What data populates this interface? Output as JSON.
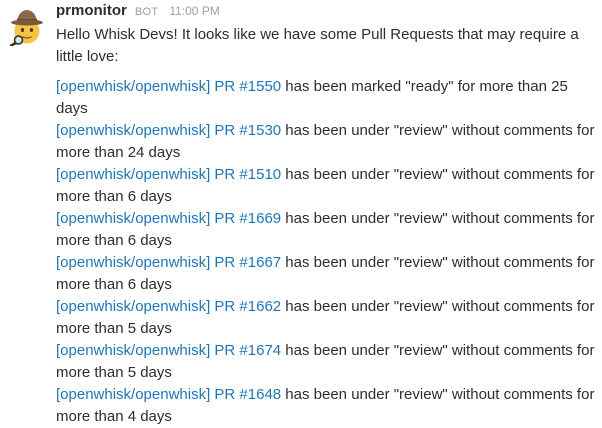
{
  "message": {
    "sender": "prmonitor",
    "badge": "BOT",
    "time": "11:00 PM",
    "avatar_icon": "detective-icon",
    "greeting": "Hello Whisk Devs! It looks like we have some Pull Requests that may require a little love:",
    "link_color": "#1f76b5",
    "prs": [
      {
        "link": "[openwhisk/openwhisk] PR #1550",
        "status": " has been marked \"ready\" for more than 25 days"
      },
      {
        "link": "[openwhisk/openwhisk] PR #1530",
        "status": " has been under \"review\" without comments for more than 24 days"
      },
      {
        "link": "[openwhisk/openwhisk] PR #1510",
        "status": " has been under \"review\" without comments for more than 6 days"
      },
      {
        "link": "[openwhisk/openwhisk] PR #1669",
        "status": " has been under \"review\" without comments for more than 6 days"
      },
      {
        "link": "[openwhisk/openwhisk] PR #1667",
        "status": " has been under \"review\" without comments for more than 6 days"
      },
      {
        "link": "[openwhisk/openwhisk] PR #1662",
        "status": " has been under \"review\" without comments for more than 5 days"
      },
      {
        "link": "[openwhisk/openwhisk] PR #1674",
        "status": " has been under \"review\" without comments for more than 5 days"
      },
      {
        "link": "[openwhisk/openwhisk] PR #1648",
        "status": " has been under \"review\" without comments for more than 4 days"
      }
    ]
  }
}
